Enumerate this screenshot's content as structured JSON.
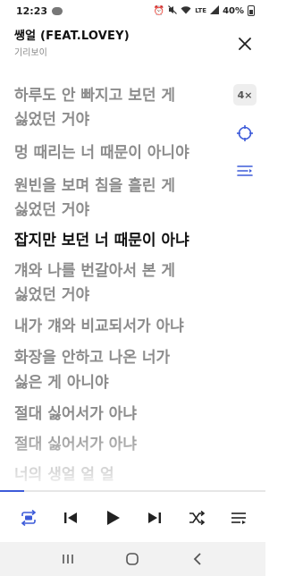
{
  "status_bar": {
    "time": "12:23",
    "battery": "40%",
    "network": "LTE"
  },
  "header": {
    "title": "쌩얼 (FEAT.LOVEY)",
    "artist": "기리보이"
  },
  "side_controls": {
    "speed": "4×"
  },
  "lyrics": [
    {
      "text": "하루도 안 빠지고 보던 게",
      "active": false
    },
    {
      "text": "싫었던 거야",
      "active": false
    },
    {
      "text": "멍 때리는 너 때문이 아니야",
      "active": false
    },
    {
      "text": "원빈을 보며 침을 흘린 게",
      "active": false
    },
    {
      "text": "싫었던 거야",
      "active": false
    },
    {
      "text": "잡지만 보던 너 때문이 아냐",
      "active": true
    },
    {
      "text": "걔와 나를 번갈아서 본 게",
      "active": false
    },
    {
      "text": "싫었던 거야",
      "active": false
    },
    {
      "text": "내가 걔와 비교되서가 아냐",
      "active": false
    },
    {
      "text": "화장을 안하고 나온 너가",
      "active": false
    },
    {
      "text": "싫은 게 아니야",
      "active": false
    },
    {
      "text": "절대 싫어서가 아냐",
      "active": false
    },
    {
      "text": "절대 싫어서가 아냐",
      "active": false
    },
    {
      "text": "너의 생얼 얼 얼",
      "active": false
    }
  ],
  "player": {
    "progress": 0.09,
    "accent_color": "#3d5bd9"
  },
  "icons": {
    "close": "close-icon",
    "target": "crosshair-icon",
    "list": "lyrics-list-icon",
    "repeat": "repeat-all-icon",
    "previous": "previous-icon",
    "play": "play-icon",
    "next": "next-icon",
    "shuffle": "shuffle-icon",
    "playlist": "playlist-icon"
  }
}
